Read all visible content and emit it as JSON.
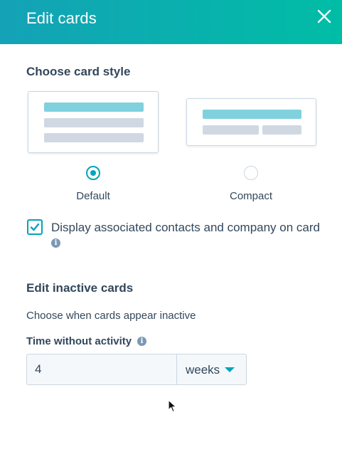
{
  "header": {
    "title": "Edit cards",
    "close_icon": "close-icon",
    "gradient_start": "#14a2b7",
    "gradient_end": "#00bda5"
  },
  "card_style": {
    "title": "Choose card style",
    "options": [
      {
        "label": "Default",
        "selected": true
      },
      {
        "label": "Compact",
        "selected": false
      }
    ],
    "accent_color": "#00a4bd"
  },
  "display_associated": {
    "label": "Display associated contacts and company on card",
    "checked": true,
    "info_icon": "info-icon"
  },
  "inactive": {
    "title": "Edit inactive cards",
    "description": "Choose when cards appear inactive",
    "field_label": "Time without activity",
    "info_icon": "info-icon",
    "value": "4",
    "unit": "weeks"
  }
}
